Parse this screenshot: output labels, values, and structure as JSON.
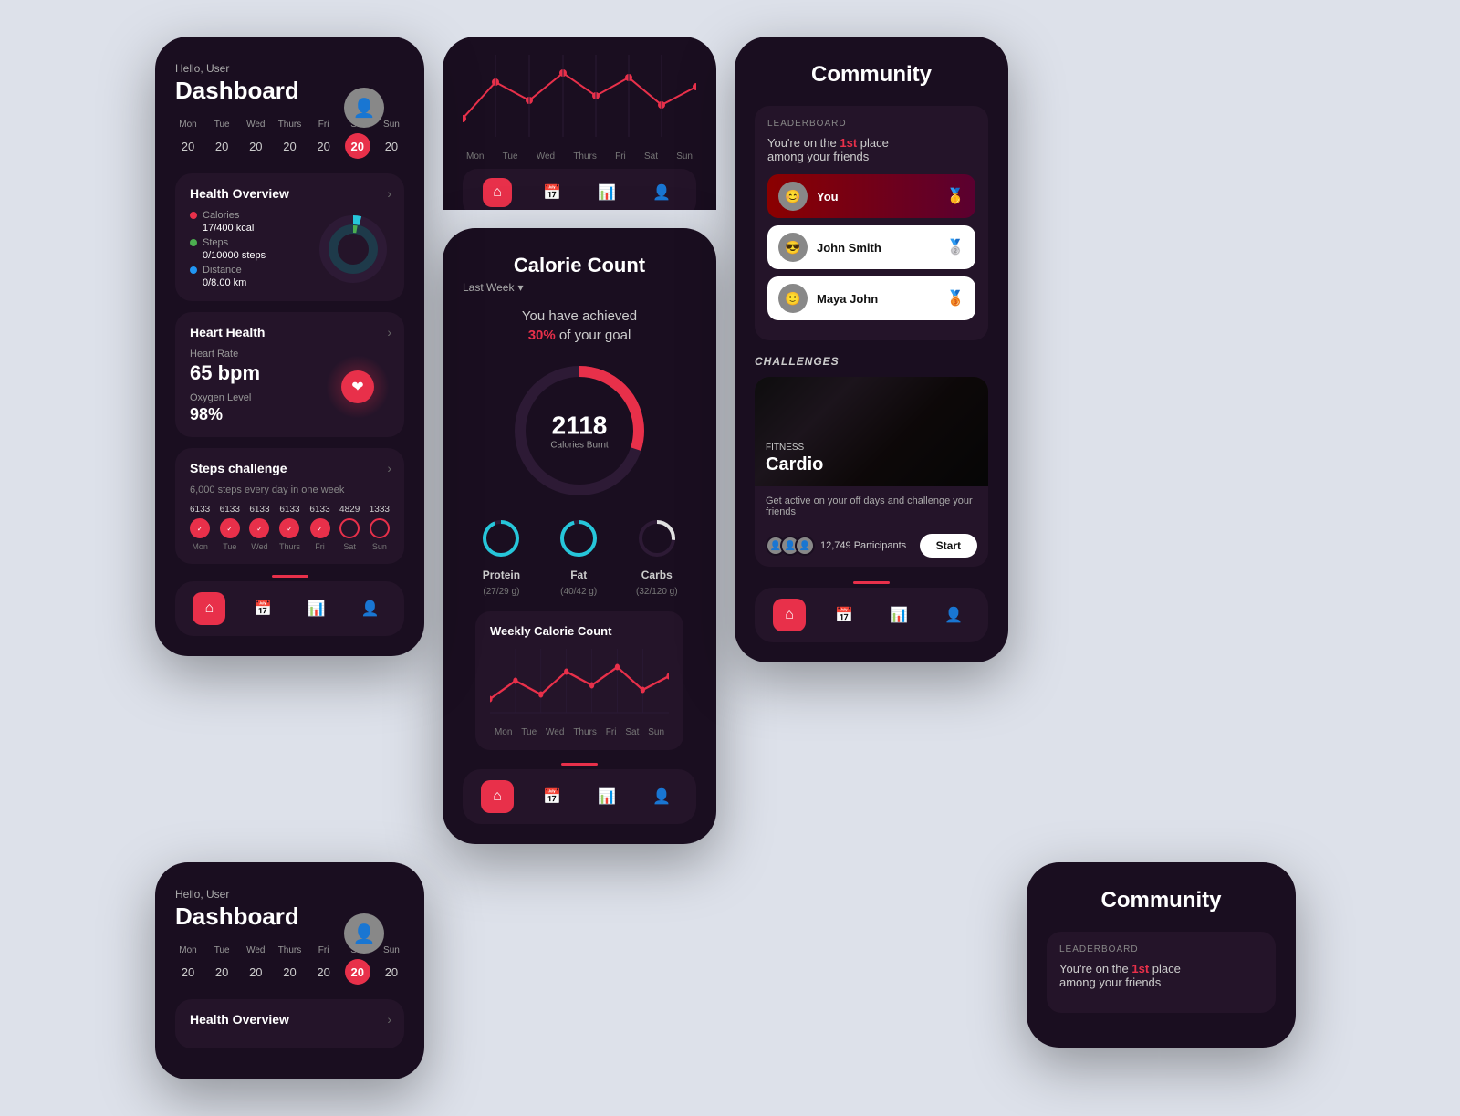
{
  "app": {
    "bg_color": "#dde1ea"
  },
  "dashboard": {
    "greeting": "Hello, User",
    "title": "Dashboard",
    "calendar": {
      "days": [
        "Mon",
        "Tue",
        "Wed",
        "Thurs",
        "Fri",
        "Sat",
        "Sun"
      ],
      "dates": [
        "20",
        "20",
        "20",
        "20",
        "20",
        "20",
        "20"
      ],
      "active_index": 5
    },
    "health_overview": {
      "title": "Health Overview",
      "calories_label": "Calories",
      "calories_value": "17/400 kcal",
      "steps_label": "Steps",
      "steps_value": "0/10000 steps",
      "distance_label": "Distance",
      "distance_value": "0/8.00 km"
    },
    "heart_health": {
      "title": "Heart Health",
      "heart_rate_label": "Heart Rate",
      "heart_rate_value": "65 bpm",
      "oxygen_label": "Oxygen Level",
      "oxygen_value": "98%"
    },
    "steps_challenge": {
      "title": "Steps challenge",
      "subtitle": "6,000 steps every day in one week",
      "days": [
        "Mon",
        "Tue",
        "Wed",
        "Thurs",
        "Fri",
        "Sat",
        "Sun"
      ],
      "counts": [
        "6133",
        "6133",
        "6133",
        "6133",
        "6133",
        "4829",
        "1333"
      ],
      "done": [
        true,
        true,
        true,
        true,
        true,
        false,
        false
      ]
    },
    "nav": {
      "items": [
        "home",
        "calendar",
        "chart",
        "user"
      ],
      "active": 0
    }
  },
  "calorie_count": {
    "title": "Calorie Count",
    "period": "Last Week",
    "goal_text": "You have achieved",
    "goal_pct": "30%",
    "goal_suffix": "of your goal",
    "calories_burnt": "2118",
    "calories_label": "Calories Burnt",
    "macros": [
      {
        "name": "Protein",
        "sub": "(27/29 g)",
        "pct": 93,
        "color": "#26c6da"
      },
      {
        "name": "Fat",
        "sub": "(40/42 g)",
        "pct": 95,
        "color": "#26c6da"
      },
      {
        "name": "Carbs",
        "sub": "(32/120 g)",
        "pct": 27,
        "color": "#f5f5f5"
      }
    ],
    "weekly_title": "Weekly Calorie Count",
    "chart_days": [
      "Mon",
      "Tue",
      "Wed",
      "Thurs",
      "Fri",
      "Sat",
      "Sun"
    ]
  },
  "community": {
    "title": "Community",
    "leaderboard": {
      "label": "LEADERBOARD",
      "subtitle_pre": "You're on the ",
      "rank": "1st",
      "subtitle_post": " place\namong your friends"
    },
    "players": [
      {
        "name": "You",
        "medal": "🥇",
        "avatar": "😊"
      },
      {
        "name": "John Smith",
        "medal": "🥈",
        "avatar": "😎"
      },
      {
        "name": "Maya John",
        "medal": "🥉",
        "avatar": "🙂"
      }
    ],
    "challenges_label": "CHALLENGES",
    "challenge": {
      "category": "FITNESS",
      "name": "Cardio",
      "desc": "Get active on your off days and challenge your friends",
      "participants": "12,749 Participants",
      "start_label": "Start"
    },
    "nav": {
      "items": [
        "home",
        "calendar",
        "chart",
        "user"
      ],
      "active": 0
    }
  },
  "partial_chart": {
    "days": [
      "Mon",
      "Tue",
      "Wed",
      "Thurs",
      "Fri",
      "Sat",
      "Sun"
    ]
  }
}
